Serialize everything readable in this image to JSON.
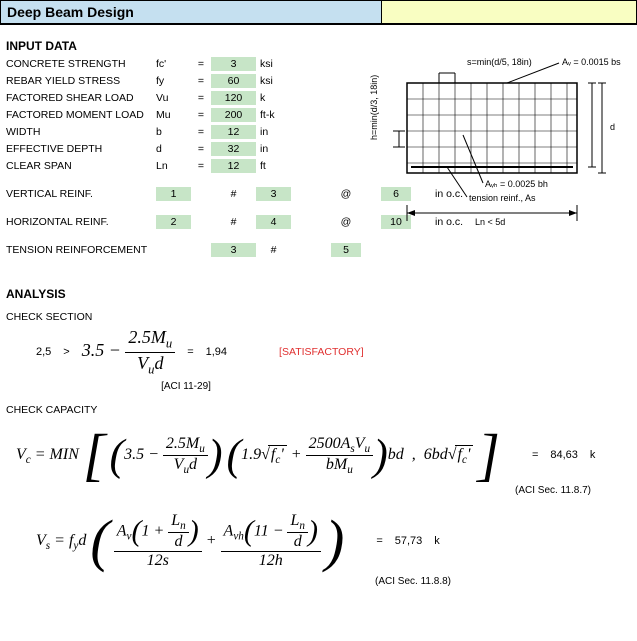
{
  "title": "Deep Beam Design",
  "input_section": "INPUT DATA",
  "inputs": {
    "concrete_strength": {
      "label": "CONCRETE STRENGTH",
      "sym": "fc'",
      "val": "3",
      "unit": "ksi"
    },
    "rebar_yield": {
      "label": "REBAR YIELD STRESS",
      "sym": "fy",
      "val": "60",
      "unit": "ksi"
    },
    "shear_load": {
      "label": "FACTORED SHEAR LOAD",
      "sym": "Vu",
      "val": "120",
      "unit": "k"
    },
    "moment_load": {
      "label": "FACTORED MOMENT LOAD",
      "sym": "Mu",
      "val": "200",
      "unit": "ft-k"
    },
    "width": {
      "label": "WIDTH",
      "sym": "b",
      "val": "12",
      "unit": "in"
    },
    "eff_depth": {
      "label": "EFFECTIVE DEPTH",
      "sym": "d",
      "val": "32",
      "unit": "in"
    },
    "clear_span": {
      "label": "CLEAR SPAN",
      "sym": "Ln",
      "val": "12",
      "unit": "ft"
    }
  },
  "vert_reinf": {
    "label": "VERTICAL REINF.",
    "qty": "1",
    "size": "3",
    "spacing": "6",
    "unit": "in o.c."
  },
  "horiz_reinf": {
    "label": "HORIZONTAL REINF.",
    "qty": "2",
    "size": "4",
    "spacing": "10",
    "unit": "in o.c."
  },
  "tension": {
    "label": "TENSION REINFORCEMENT",
    "qty": "3",
    "size": "5"
  },
  "hash": "#",
  "at": "@",
  "eq": "=",
  "diagram": {
    "s_label": "s=min(d/5, 18in)",
    "av_label": "Aᵥ = 0.0015 bs",
    "h_label": "h=min(d/3, 18in)",
    "d_label": "d",
    "avh_label": "Aᵥₕ = 0.0025 bh",
    "tension_label": "tension reinf., As",
    "ln_label": "Ln < 5d"
  },
  "analysis_section": "ANALYSIS",
  "check_section": {
    "label": "CHECK SECTION",
    "lhs": "2,5",
    "gt": ">",
    "result": "1,94",
    "status": "[SATISFACTORY]",
    "ref": "[ACI 11-29]"
  },
  "check_capacity": {
    "label": "CHECK CAPACITY",
    "vc_result": "84,63",
    "vc_unit": "k",
    "vc_ref": "(ACI Sec. 11.8.7)",
    "vs_result": "57,73",
    "vs_unit": "k",
    "vs_ref": "(ACI Sec. 11.8.8)"
  }
}
